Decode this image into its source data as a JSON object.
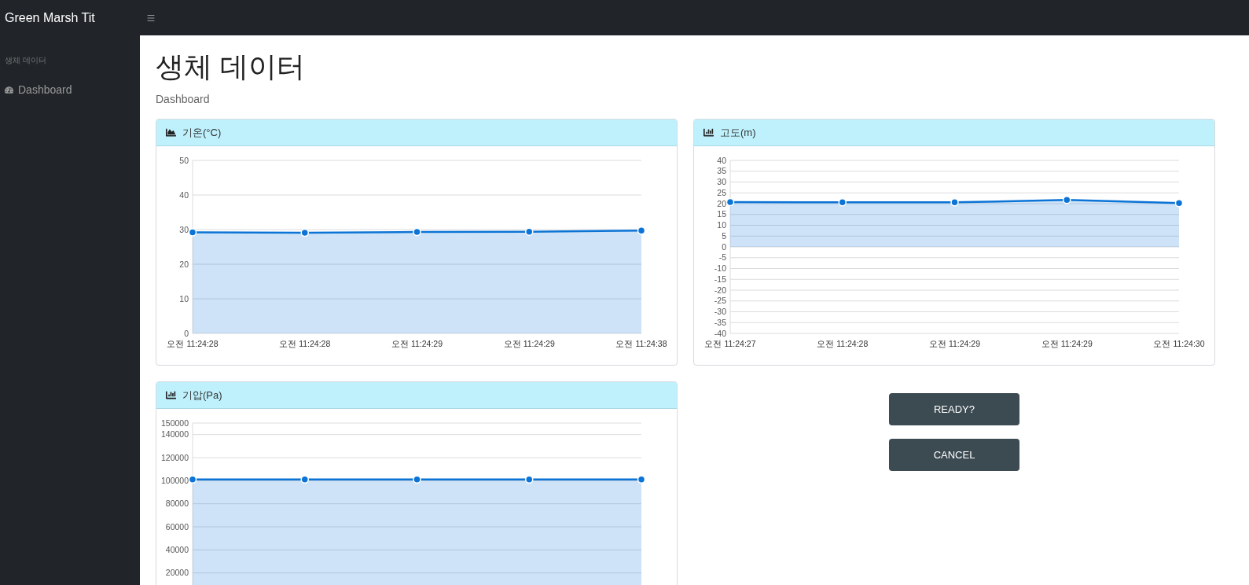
{
  "navbar": {
    "brand": "Green Marsh Tit"
  },
  "sidebar": {
    "heading": "생체 데이터",
    "items": [
      {
        "label": "Dashboard"
      }
    ]
  },
  "page": {
    "title": "생체 데이터",
    "subtitle": "Dashboard"
  },
  "cards": [
    {
      "title": "기온(°C)",
      "kind": "area",
      "chart_data": {
        "type": "area",
        "categories": [
          "오전 11:24:28",
          "오전 11:24:28",
          "오전 11:24:29",
          "오전 11:24:29",
          "오전 11:24:38"
        ],
        "series": [
          {
            "color": "#0b74d6",
            "values": [
              29.2,
              29.1,
              29.3,
              29.4,
              29.7
            ]
          }
        ],
        "grid": true,
        "ylim": [
          0,
          50
        ],
        "yticks": [
          0,
          10,
          20,
          30,
          40,
          50
        ]
      }
    },
    {
      "title": "고도(m)",
      "kind": "bar",
      "chart_data": {
        "type": "area",
        "categories": [
          "오전 11:24:27",
          "오전 11:24:28",
          "오전 11:24:29",
          "오전 11:24:29",
          "오전 11:24:30"
        ],
        "series": [
          {
            "color": "#0b74d6",
            "values": [
              20.7,
              20.6,
              20.6,
              21.7,
              20.3
            ]
          }
        ],
        "grid": true,
        "ylim": [
          -40,
          40
        ],
        "yticks": [
          -40,
          -35,
          -30,
          -25,
          -20,
          -15,
          -10,
          -5,
          0,
          5,
          10,
          15,
          20,
          25,
          30,
          35,
          40
        ]
      }
    },
    {
      "title": "기압(Pa)",
      "kind": "bar",
      "chart_data": {
        "type": "area",
        "series": [
          {
            "color": "#0b74d6",
            "values": [
              101000,
              101000,
              101000,
              101000,
              101000
            ]
          }
        ],
        "grid": true,
        "ylim": [
          0,
          150000
        ],
        "yticks": [
          20000,
          40000,
          60000,
          80000,
          100000,
          120000,
          140000,
          150000
        ]
      }
    }
  ],
  "buttons": [
    {
      "label": "READY?"
    },
    {
      "label": "CANCEL"
    }
  ]
}
